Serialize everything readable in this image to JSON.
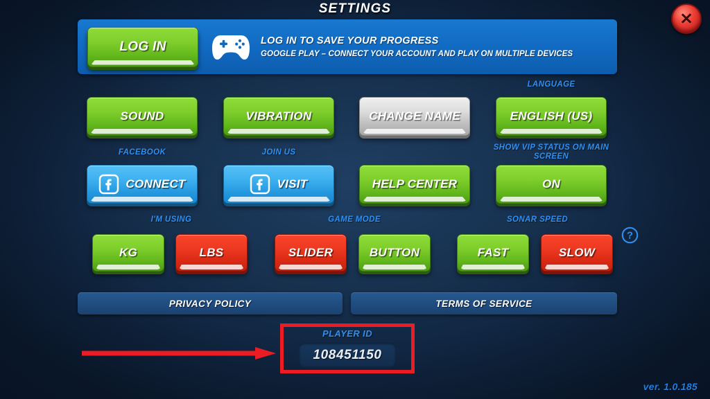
{
  "window": {
    "title": "SETTINGS",
    "version": "ver. 1.0.185",
    "close_label": "✕"
  },
  "colors": {
    "green": "#7ece2c",
    "red": "#ef3a22",
    "blue": "#3fb2f0",
    "grey": "#dedede",
    "caption_blue": "#2f8ff0",
    "banner_blue": "#1169c0",
    "annotation_red": "#ec1c24",
    "background_navy": "#17314f"
  },
  "login_banner": {
    "button_label": "LOG IN",
    "icon": "gamepad-icon",
    "headline": "LOG IN TO SAVE YOUR PROGRESS",
    "subline": "GOOGLE PLAY – CONNECT YOUR ACCOUNT AND PLAY ON MULTIPLE DEVICES"
  },
  "rows": {
    "row1": {
      "sound": {
        "label": "SOUND",
        "color": "green"
      },
      "vibration": {
        "label": "VIBRATION",
        "color": "green"
      },
      "change_name": {
        "label": "CHANGE NAME",
        "color": "grey"
      },
      "language": {
        "caption": "LANGUAGE",
        "label": "ENGLISH (US)",
        "color": "green"
      }
    },
    "row2": {
      "facebook": {
        "caption": "FACEBOOK",
        "label": "CONNECT",
        "color": "blue",
        "icon": "facebook-icon"
      },
      "join_us": {
        "caption": "JOIN US",
        "label": "VISIT",
        "color": "blue",
        "icon": "facebook-icon"
      },
      "help_center": {
        "label": "HELP CENTER",
        "color": "green"
      },
      "vip_status": {
        "caption": "SHOW VIP STATUS ON MAIN SCREEN",
        "label": "ON",
        "color": "green"
      }
    },
    "row3": {
      "units": {
        "caption": "I'M USING",
        "options": [
          {
            "label": "KG",
            "color": "green"
          },
          {
            "label": "LBS",
            "color": "red"
          }
        ]
      },
      "game_mode": {
        "caption": "GAME MODE",
        "options": [
          {
            "label": "SLIDER",
            "color": "red"
          },
          {
            "label": "BUTTON",
            "color": "green"
          }
        ]
      },
      "sonar_speed": {
        "caption": "SONAR SPEED",
        "options": [
          {
            "label": "FAST",
            "color": "green"
          },
          {
            "label": "SLOW",
            "color": "red"
          }
        ]
      },
      "help_icon": "question-mark-icon"
    }
  },
  "legal": {
    "privacy_policy": "PRIVACY POLICY",
    "terms_of_service": "TERMS OF SERVICE"
  },
  "player_id": {
    "label": "PLAYER ID",
    "value": "108451150"
  },
  "annotations": {
    "highlight_target": "player-id-block",
    "arrow_direction": "right",
    "color": "#ec1c24"
  }
}
